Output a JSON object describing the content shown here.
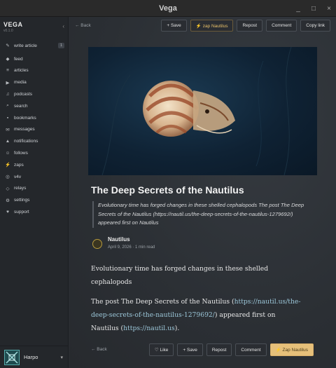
{
  "window": {
    "title": "Vega",
    "controls": [
      "_",
      "□",
      "×"
    ]
  },
  "sidebar": {
    "brand": "VEGA",
    "version": "v0.1.0",
    "collapse_icon": "‹",
    "items": [
      {
        "icon": "✎",
        "label": "write article",
        "badge": "1"
      },
      {
        "icon": "◆",
        "label": "feed"
      },
      {
        "icon": "≡",
        "label": "articles"
      },
      {
        "icon": "▶",
        "label": "media"
      },
      {
        "icon": "♫",
        "label": "podcasts"
      },
      {
        "icon": "⌕",
        "label": "search"
      },
      {
        "icon": "▪",
        "label": "bookmarks"
      },
      {
        "icon": "✉",
        "label": "messages"
      },
      {
        "icon": "▲",
        "label": "notifications"
      },
      {
        "icon": "☺",
        "label": "follows"
      },
      {
        "icon": "⚡",
        "label": "zaps"
      },
      {
        "icon": "◎",
        "label": "v4v"
      },
      {
        "icon": "◇",
        "label": "relays"
      },
      {
        "icon": "⚙",
        "label": "settings"
      },
      {
        "icon": "♥",
        "label": "support"
      }
    ],
    "user": {
      "name": "Harpo",
      "caret": "▾"
    }
  },
  "toolbar": {
    "back": "← Back",
    "save": "+ Save",
    "zap": "⚡ zap Nautilus",
    "repost": "Repost",
    "comment": "Comment",
    "copy_link": "Copy link"
  },
  "article": {
    "title": "The Deep Secrets of the Nautilus",
    "summary": "Evolutionary time has forged changes in these shelled cephalopods The post The Deep Secrets of the Nautilus (https://nautil.us/the-deep-secrets-of-the-nautilus-1279692/) appeared first on Nautilus",
    "author": "Nautilus",
    "meta": "April 9, 2026 · 1 min read",
    "para1": "Evolutionary time has forged changes in these shelled cephalopods",
    "para2_pre": "The post The Deep Secrets of the Nautilus (",
    "para2_link": "https://nautil.us/the-deep-secrets-of-the-nautilus-1279692/",
    "para2_post": ") appeared first on Nautilus (",
    "para2_link2": "https://nautil.us",
    "para2_end": ")."
  },
  "bottom": {
    "back": "← Back",
    "like": "♡ Like",
    "save": "+ Save",
    "repost": "Repost",
    "comment": "Comment",
    "zap": "⚡ Zap Nautilus"
  }
}
